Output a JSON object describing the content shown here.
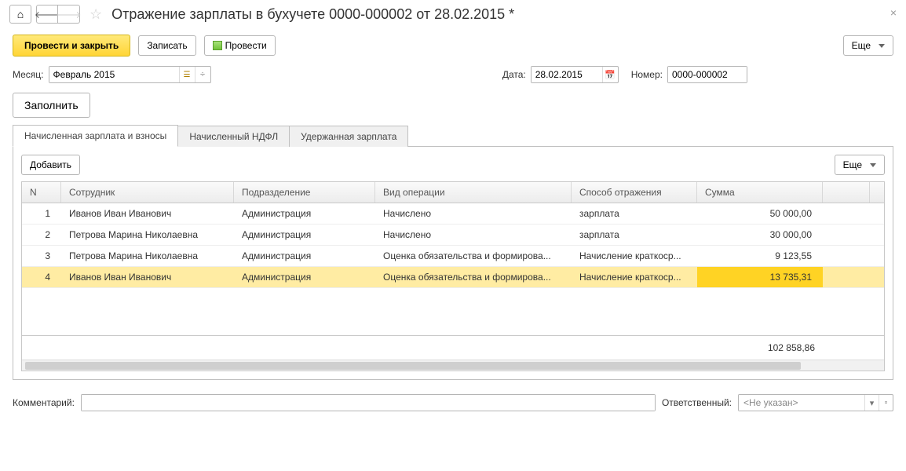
{
  "title": "Отражение зарплаты в бухучете 0000-000002 от 28.02.2015 *",
  "toolbar": {
    "post_close": "Провести и закрыть",
    "save": "Записать",
    "post": "Провести",
    "more": "Еще"
  },
  "form": {
    "month_label": "Месяц:",
    "month_value": "Февраль 2015",
    "date_label": "Дата:",
    "date_value": "28.02.2015",
    "number_label": "Номер:",
    "number_value": "0000-000002"
  },
  "fill_button": "Заполнить",
  "tabs": {
    "t1": "Начисленная зарплата и взносы",
    "t2": "Начисленный НДФЛ",
    "t3": "Удержанная зарплата"
  },
  "panel": {
    "add": "Добавить",
    "more": "Еще"
  },
  "columns": {
    "n": "N",
    "employee": "Сотрудник",
    "department": "Подразделение",
    "operation": "Вид операции",
    "method": "Способ отражения",
    "amount": "Сумма"
  },
  "rows": [
    {
      "n": "1",
      "employee": "Иванов Иван Иванович",
      "department": "Администрация",
      "operation": "Начислено",
      "method": "зарплата",
      "amount": "50 000,00"
    },
    {
      "n": "2",
      "employee": "Петрова Марина Николаевна",
      "department": "Администрация",
      "operation": "Начислено",
      "method": "зарплата",
      "amount": "30 000,00"
    },
    {
      "n": "3",
      "employee": "Петрова Марина Николаевна",
      "department": "Администрация",
      "operation": "Оценка обязательства и формирова...",
      "method": "Начисление краткоср...",
      "amount": "9 123,55"
    },
    {
      "n": "4",
      "employee": "Иванов Иван Иванович",
      "department": "Администрация",
      "operation": "Оценка обязательства и формирова...",
      "method": "Начисление краткоср...",
      "amount": "13 735,31"
    }
  ],
  "total": "102 858,86",
  "footer": {
    "comment_label": "Комментарий:",
    "comment_value": "",
    "responsible_label": "Ответственный:",
    "responsible_value": "<Не указан>"
  }
}
